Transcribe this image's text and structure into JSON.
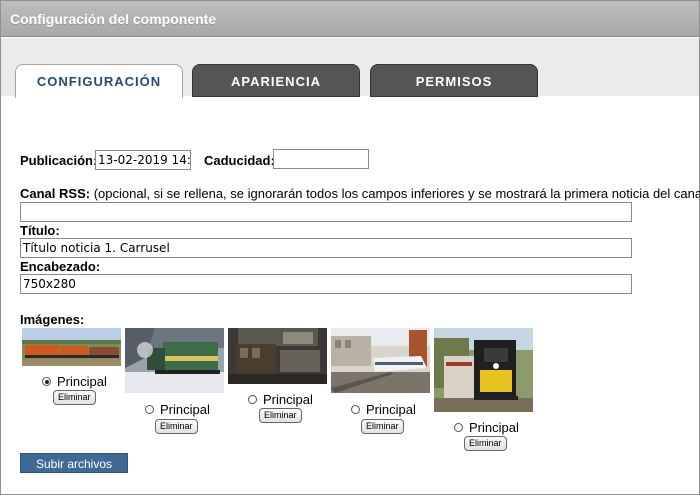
{
  "window": {
    "title": "Configuración del componente"
  },
  "tabs": [
    {
      "label": "CONFIGURACIÓN",
      "active": true
    },
    {
      "label": "APARIENCIA",
      "active": false
    },
    {
      "label": "PERMISOS",
      "active": false
    }
  ],
  "form": {
    "publicacion_label": "Publicación:",
    "publicacion_value": "13-02-2019 14:",
    "caducidad_label": "Caducidad:",
    "caducidad_value": "",
    "rss_label": "Canal RSS:",
    "rss_hint": "(opcional, si se rellena, se ignorarán todos los campos inferiores y se mostrará la primera noticia del canal):",
    "rss_value": "",
    "titulo_label": "Título:",
    "titulo_value": "Título noticia 1. Carrusel",
    "encabezado_label": "Encabezado:",
    "encabezado_value": "750x280",
    "imagenes_label": "Imágenes:"
  },
  "images": [
    {
      "caption": "Principal",
      "selected": true,
      "delete_label": "Eliminar",
      "subject": "freight-train-photo"
    },
    {
      "caption": "Principal",
      "selected": false,
      "delete_label": "Eliminar",
      "subject": "snow-locomotive-photo"
    },
    {
      "caption": "Principal",
      "selected": false,
      "delete_label": "Eliminar",
      "subject": "depot-train-photo"
    },
    {
      "caption": "Principal",
      "selected": false,
      "delete_label": "Eliminar",
      "subject": "high-speed-train-photo"
    },
    {
      "caption": "Principal",
      "selected": false,
      "delete_label": "Eliminar",
      "subject": "yellow-locomotive-photo"
    }
  ],
  "upload_label": "Subir archivos",
  "colors": {
    "accent": "#254a75",
    "tab_inactive": "#555555",
    "button": "#3f6a95",
    "titlebar": "#b3b3b3"
  }
}
